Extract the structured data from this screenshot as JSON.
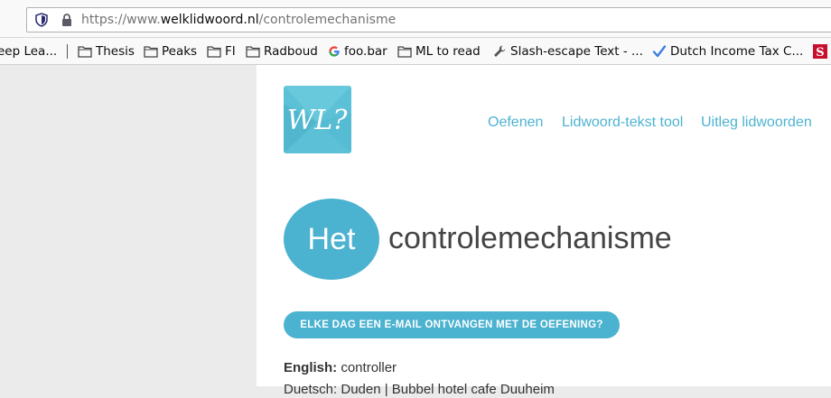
{
  "browser": {
    "url_prefix": "https://www.",
    "url_domain": "welklidwoord.nl",
    "url_path": "/controlemechanisme"
  },
  "bookmarks": [
    {
      "label": "eep Lea...",
      "icon": "none"
    },
    {
      "label": "Thesis",
      "icon": "folder-icon"
    },
    {
      "label": "Peaks",
      "icon": "folder-icon"
    },
    {
      "label": "FI",
      "icon": "folder-icon"
    },
    {
      "label": "Radboud",
      "icon": "folder-icon"
    },
    {
      "label": "foo.bar",
      "icon": "google-icon"
    },
    {
      "label": "ML to read",
      "icon": "folder-icon"
    },
    {
      "label": "Slash-escape Text - ...",
      "icon": "wrench-icon"
    },
    {
      "label": "Dutch Income Tax C...",
      "icon": "checkmark-icon"
    },
    {
      "label": "",
      "icon": "s-logo-icon"
    }
  ],
  "site": {
    "logo_text": "WL?",
    "nav": [
      {
        "label": "Oefenen"
      },
      {
        "label": "Lidwoord-tekst tool"
      },
      {
        "label": "Uitleg lidwoorden"
      }
    ],
    "article": "Het",
    "word": "controlemechanisme",
    "cta_label": "ELKE DAG EEN E-MAIL ONTVANGEN MET DE OEFENING?",
    "english_label": "English:",
    "english_value": "controller",
    "partial_line": "Duetsch: Duden | Bubbel hotel cafe Duuheim"
  },
  "colors": {
    "accent": "#4bb2d0",
    "logo_bg": "#5cc0d6"
  }
}
